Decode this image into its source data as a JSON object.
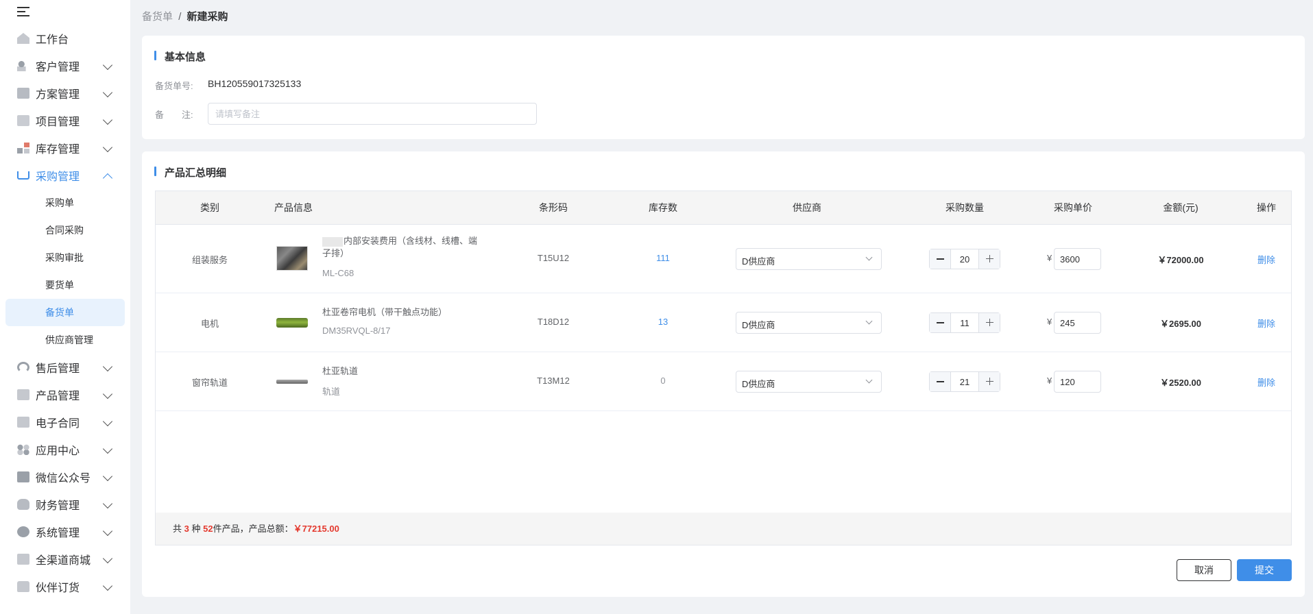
{
  "sidebar": {
    "items": [
      {
        "label": "工作台"
      },
      {
        "label": "客户管理"
      },
      {
        "label": "方案管理"
      },
      {
        "label": "项目管理"
      },
      {
        "label": "库存管理"
      },
      {
        "label": "采购管理"
      },
      {
        "label": "售后管理"
      },
      {
        "label": "产品管理"
      },
      {
        "label": "电子合同"
      },
      {
        "label": "应用中心"
      },
      {
        "label": "微信公众号"
      },
      {
        "label": "财务管理"
      },
      {
        "label": "系统管理"
      },
      {
        "label": "全渠道商城"
      },
      {
        "label": "伙伴订货"
      }
    ],
    "purchase_sub": [
      {
        "label": "采购单"
      },
      {
        "label": "合同采购"
      },
      {
        "label": "采购审批"
      },
      {
        "label": "要货单"
      },
      {
        "label": "备货单"
      },
      {
        "label": "供应商管理"
      }
    ],
    "active_color": "#3f8ee8"
  },
  "breadcrumb": {
    "parent": "备货单",
    "sep": "/",
    "current": "新建采购"
  },
  "basic": {
    "title": "基本信息",
    "order_no_label": "备货单号:",
    "order_no": "BH120559017325133",
    "remark_label": "备　　注:",
    "remark_placeholder": "请填写备注",
    "remark_value": ""
  },
  "products": {
    "title": "产品汇总明细",
    "columns": [
      "类别",
      "产品信息",
      "条形码",
      "库存数",
      "供应商",
      "采购数量",
      "采购单价",
      "金额(元)",
      "操作"
    ],
    "rows": [
      {
        "category": "组装服务",
        "name": "内部安装费用（含线材、线槽、端子排）",
        "code": "ML-C68",
        "barcode": "T15U12",
        "stock": "111",
        "supplier": "D供应商",
        "qty": "20",
        "yen": "¥",
        "price": "3600",
        "amount": "￥72000.00",
        "action": "删除"
      },
      {
        "category": "电机",
        "name": "杜亚卷帘电机（带干触点功能）",
        "code": "DM35RVQL-8/17",
        "barcode": "T18D12",
        "stock": "13",
        "supplier": "D供应商",
        "qty": "11",
        "yen": "¥",
        "price": "245",
        "amount": "￥2695.00",
        "action": "删除"
      },
      {
        "category": "窗帘轨道",
        "name": "杜亚轨道",
        "code": "轨道",
        "barcode": "T13M12",
        "stock": "0",
        "supplier": "D供应商",
        "qty": "21",
        "yen": "¥",
        "price": "120",
        "amount": "￥2520.00",
        "action": "删除"
      }
    ],
    "summary": {
      "prefix": "共",
      "kinds": "3",
      "mid1": "种",
      "count": "52",
      "mid2": "件产品，产品总额：",
      "total": "￥77215.00"
    }
  },
  "actions": {
    "cancel": "取消",
    "submit": "提交"
  }
}
